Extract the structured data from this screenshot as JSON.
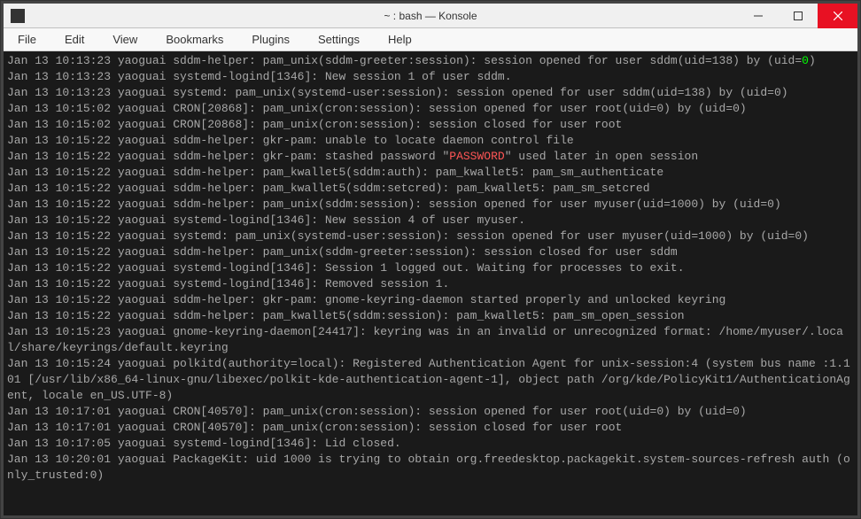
{
  "window": {
    "title": "~ : bash — Konsole"
  },
  "menu": {
    "file": "File",
    "edit": "Edit",
    "view": "View",
    "bookmarks": "Bookmarks",
    "plugins": "Plugins",
    "settings": "Settings",
    "help": "Help"
  },
  "log": {
    "l01a": "Jan 13 10:13:23 yaoguai sddm-helper: pam_unix(sddm-greeter:session): session opened for user sddm(uid=138) by (uid=",
    "l01b": "0",
    "l01c": ")",
    "l02": "Jan 13 10:13:23 yaoguai systemd-logind[1346]: New session 1 of user sddm.",
    "l03": "Jan 13 10:13:23 yaoguai systemd: pam_unix(systemd-user:session): session opened for user sddm(uid=138) by (uid=0)",
    "l04": "Jan 13 10:15:02 yaoguai CRON[20868]: pam_unix(cron:session): session opened for user root(uid=0) by (uid=0)",
    "l05": "Jan 13 10:15:02 yaoguai CRON[20868]: pam_unix(cron:session): session closed for user root",
    "l06": "Jan 13 10:15:22 yaoguai sddm-helper: gkr-pam: unable to locate daemon control file",
    "l07a": "Jan 13 10:15:22 yaoguai sddm-helper: gkr-pam: stashed password \"",
    "l07b": "PASSWORD",
    "l07c": "\" used later in open session",
    "l08": "Jan 13 10:15:22 yaoguai sddm-helper: pam_kwallet5(sddm:auth): pam_kwallet5: pam_sm_authenticate",
    "l09": "Jan 13 10:15:22 yaoguai sddm-helper: pam_kwallet5(sddm:setcred): pam_kwallet5: pam_sm_setcred",
    "l10": "Jan 13 10:15:22 yaoguai sddm-helper: pam_unix(sddm:session): session opened for user myuser(uid=1000) by (uid=0)",
    "l11": "Jan 13 10:15:22 yaoguai systemd-logind[1346]: New session 4 of user myuser.",
    "l12a": "Jan 13 10:15:22 yaoguai systemd: pam_unix(systemd-user:session): session opened for user myuser(uid=1000) by (uid=0",
    "l12b": ")",
    "l13": "Jan 13 10:15:22 yaoguai sddm-helper: pam_unix(sddm-greeter:session): session closed for user sddm",
    "l14": "Jan 13 10:15:22 yaoguai systemd-logind[1346]: Session 1 logged out. Waiting for processes to exit.",
    "l15": "Jan 13 10:15:22 yaoguai systemd-logind[1346]: Removed session 1.",
    "l16": "Jan 13 10:15:22 yaoguai sddm-helper: gkr-pam: gnome-keyring-daemon started properly and unlocked keyring",
    "l17": "Jan 13 10:15:22 yaoguai sddm-helper: pam_kwallet5(sddm:session): pam_kwallet5: pam_sm_open_session",
    "l18": "Jan 13 10:15:23 yaoguai gnome-keyring-daemon[24417]: keyring was in an invalid or unrecognized format: /home/myuser/.local/share/keyrings/default.keyring",
    "l19": "Jan 13 10:15:24 yaoguai polkitd(authority=local): Registered Authentication Agent for unix-session:4 (system bus name :1.101 [/usr/lib/x86_64-linux-gnu/libexec/polkit-kde-authentication-agent-1], object path /org/kde/PolicyKit1/AuthenticationAgent, locale en_US.UTF-8)",
    "l20": "Jan 13 10:17:01 yaoguai CRON[40570]: pam_unix(cron:session): session opened for user root(uid=0) by (uid=0)",
    "l21": "Jan 13 10:17:01 yaoguai CRON[40570]: pam_unix(cron:session): session closed for user root",
    "l22": "Jan 13 10:17:05 yaoguai systemd-logind[1346]: Lid closed.",
    "l23": "Jan 13 10:20:01 yaoguai PackageKit: uid 1000 is trying to obtain org.freedesktop.packagekit.system-sources-refresh auth (only_trusted:0)"
  }
}
